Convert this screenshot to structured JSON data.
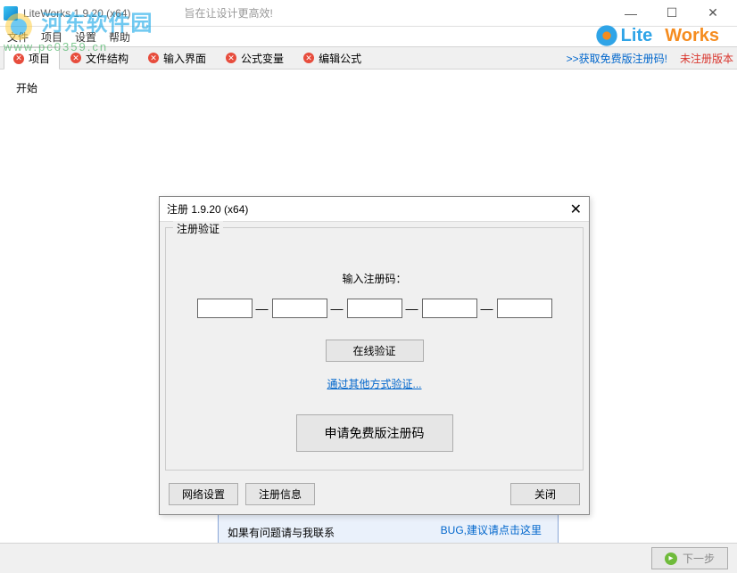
{
  "window": {
    "title": "LiteWorks 1.9.20 (x64)",
    "tagline": "旨在让设计更高效!"
  },
  "menu": {
    "file": "文件",
    "project": "项目",
    "settings": "设置",
    "help": "帮助"
  },
  "brand": {
    "lite": "Lite",
    "works": "Works"
  },
  "tabs": {
    "project": "项目",
    "structure": "文件结构",
    "input": "输入界面",
    "vars": "公式变量",
    "edit": "编辑公式"
  },
  "links": {
    "getcode": ">>获取免费版注册码!",
    "unregistered": "未注册版本"
  },
  "start_label": "开始",
  "dialog": {
    "title": "注册 1.9.20 (x64)",
    "group": "注册验证",
    "prompt": "输入注册码：",
    "verify_btn": "在线验证",
    "other_link": "通过其他方式验证...",
    "free_btn": "申请免费版注册码",
    "net_btn": "网络设置",
    "info_btn": "注册信息",
    "close_btn": "关闭"
  },
  "bg": {
    "contact": "如果有问题请与我联系",
    "bug": "BUG,建议请点击这里"
  },
  "footer": {
    "next": "下一步"
  },
  "watermark": {
    "text": "河东软件园",
    "url": "www.pc0359.cn"
  }
}
